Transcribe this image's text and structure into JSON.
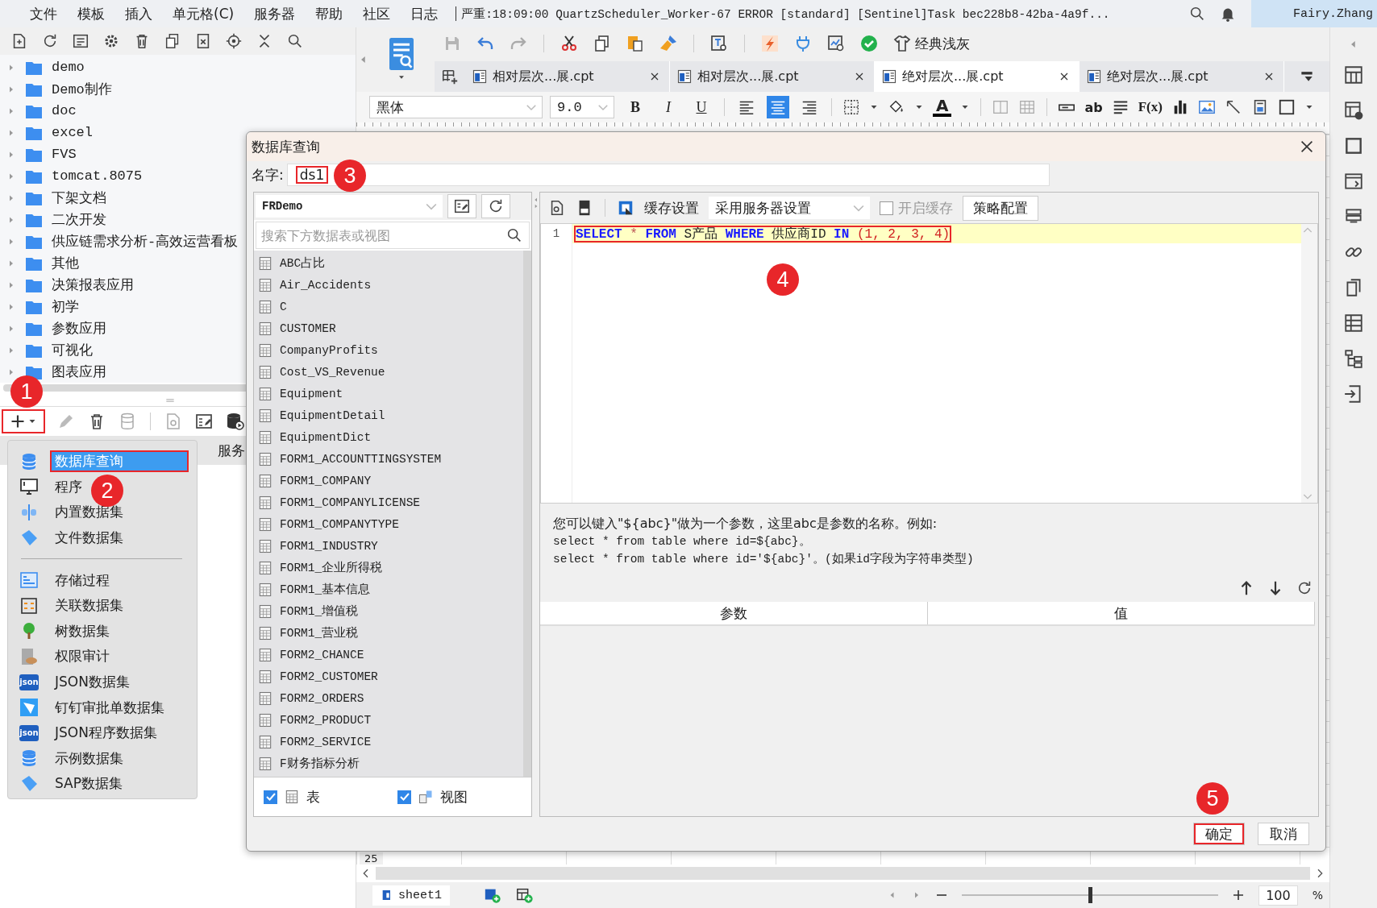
{
  "menubar": {
    "items": [
      "文件",
      "模板",
      "插入",
      "单元格(C)",
      "服务器",
      "帮助",
      "社区",
      "日志"
    ],
    "log_message": "严重:18:09:00 QuartzScheduler_Worker-67 ERROR [standard] [Sentinel]Task bec228b8-42ba-4a9f...",
    "user": "Fairy.Zhang"
  },
  "file_tree": [
    "demo",
    "Demo制作",
    "doc",
    "excel",
    "FVS",
    "tomcat.8075",
    "下架文档",
    "二次开发",
    "供应链需求分析-高效运营看板",
    "其他",
    "决策报表应用",
    "初学",
    "参数应用",
    "可视化",
    "图表应用"
  ],
  "dataset_panel": {
    "add_button_annotated": true,
    "tab_label": "服务"
  },
  "add_menu": {
    "groups": [
      [
        {
          "label": "数据库查询",
          "selected": true,
          "annotated": true
        },
        {
          "label": "程序",
          "selected": false
        },
        {
          "label": "内置数据集",
          "selected": false
        },
        {
          "label": "文件数据集",
          "selected": false
        }
      ],
      [
        {
          "label": "存储过程",
          "selected": false
        },
        {
          "label": "关联数据集",
          "selected": false
        },
        {
          "label": "树数据集",
          "selected": false
        },
        {
          "label": "权限审计",
          "selected": false
        },
        {
          "label": "JSON数据集",
          "selected": false,
          "icon_text": "json"
        },
        {
          "label": "钉钉审批单数据集",
          "selected": false
        },
        {
          "label": "JSON程序数据集",
          "selected": false,
          "icon_text": "json"
        },
        {
          "label": "示例数据集",
          "selected": false
        },
        {
          "label": "SAP数据集",
          "selected": false
        }
      ]
    ]
  },
  "toolbar": {
    "theme_button": "经典浅灰"
  },
  "editor_tabs": [
    {
      "label": "相对层次...展.cpt",
      "selected": false
    },
    {
      "label": "相对层次...展.cpt",
      "selected": false
    },
    {
      "label": "绝对层次...展.cpt",
      "selected": true
    },
    {
      "label": "绝对层次...展.cpt",
      "selected": false
    }
  ],
  "format_bar": {
    "font": "黑体",
    "size": "9.0",
    "style_buttons": [
      "B",
      "I",
      "U"
    ],
    "align_buttons": [
      {
        "selected": false
      },
      {
        "selected": true
      },
      {
        "selected": false
      }
    ],
    "font_color_button": "A",
    "text_tool": "ab",
    "formula_tool": "F(x)"
  },
  "sheet": {
    "row_header": "25",
    "tab": "sheet1",
    "zoom": "100",
    "percent": "%",
    "level": 0.5
  },
  "dialog": {
    "title": "数据库查询",
    "name_label": "名字:",
    "name_value": "ds1",
    "name_annotated": true,
    "connection": "FRDemo",
    "search_placeholder": "搜索下方数据表或视图",
    "tables": [
      "ABC占比",
      "Air_Accidents",
      "C",
      "CUSTOMER",
      "CompanyProfits",
      "Cost_VS_Revenue",
      "Equipment",
      "EquipmentDetail",
      "EquipmentDict",
      "FORM1_ACCOUNTTINGSYSTEM",
      "FORM1_COMPANY",
      "FORM1_COMPANYLICENSE",
      "FORM1_COMPANYTYPE",
      "FORM1_INDUSTRY",
      "FORM1_企业所得税",
      "FORM1_基本信息",
      "FORM1_增值税",
      "FORM1_营业税",
      "FORM2_CHANCE",
      "FORM2_CUSTOMER",
      "FORM2_ORDERS",
      "FORM2_PRODUCT",
      "FORM2_SERVICE",
      "F财务指标分析"
    ],
    "show_tables": {
      "label": "表",
      "checked": true
    },
    "show_views": {
      "label": "视图",
      "checked": true
    },
    "cache_label": "缓存设置",
    "cache_mode": "采用服务器设置",
    "enable_cache": {
      "label": "开启缓存",
      "checked": false
    },
    "strategy_button": "策略配置",
    "sql_line_number": "1",
    "sql_annotated": true,
    "sql_tokens": [
      {
        "text": "SELECT",
        "kind": "keyword"
      },
      {
        "text": "*",
        "kind": "operator"
      },
      {
        "text": "FROM",
        "kind": "keyword"
      },
      {
        "text": "S产品",
        "kind": "plain"
      },
      {
        "text": "WHERE",
        "kind": "keyword"
      },
      {
        "text": "供应商ID",
        "kind": "plain"
      },
      {
        "text": "IN",
        "kind": "keyword"
      },
      {
        "text": "(1, 2, 3, 4)",
        "kind": "number"
      }
    ],
    "hint": [
      "您可以键入\"${abc}\"做为一个参数，这里abc是参数的名称。例如:",
      "select * from table where id=${abc}。",
      "select * from table where id='${abc}'。(如果id字段为字符串类型)"
    ],
    "param_columns": [
      "参数",
      "值"
    ],
    "ok_button": "确定",
    "ok_annotated": true,
    "cancel_button": "取消"
  },
  "callouts": [
    "1",
    "2",
    "3",
    "4",
    "5"
  ]
}
